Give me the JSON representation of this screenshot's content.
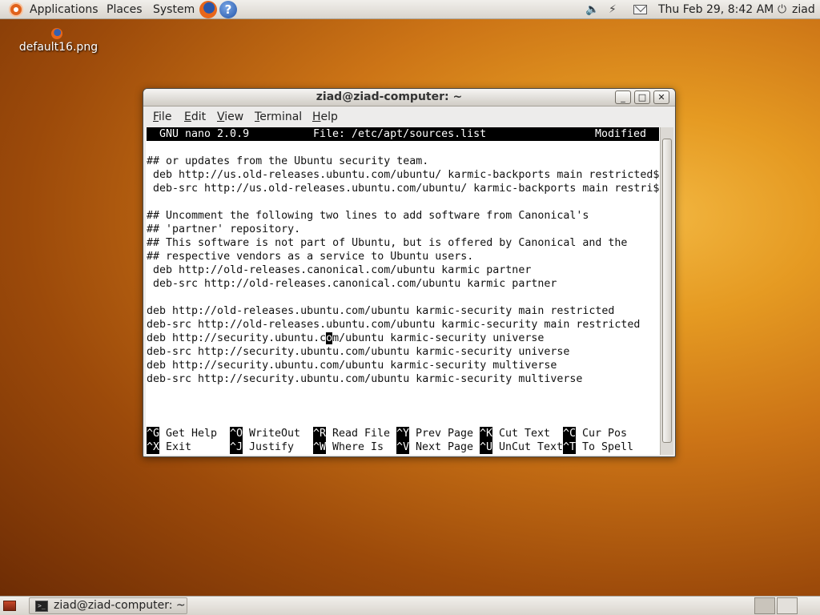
{
  "top_panel": {
    "menus": [
      "Applications",
      "Places",
      "System"
    ],
    "help_glyph": "?",
    "clock": "Thu Feb 29,  8:42 AM",
    "user": "ziad",
    "icons": [
      "ubuntu-logo-icon",
      "firefox-icon",
      "help-icon",
      "volume-icon",
      "network-icon",
      "mail-icon",
      "power-icon"
    ]
  },
  "desktop": {
    "icon_label": "default16.png"
  },
  "window": {
    "title": "ziad@ziad-computer: ~",
    "buttons": {
      "minimize": "_",
      "maximize": "□",
      "close": "✕"
    },
    "menus": [
      "File",
      "Edit",
      "View",
      "Terminal",
      "Help"
    ]
  },
  "nano": {
    "version": "GNU nano 2.0.9",
    "file": "File: /etc/apt/sources.list",
    "status": "Modified",
    "lines": [
      "",
      "## or updates from the Ubuntu security team.",
      " deb http://us.old-releases.ubuntu.com/ubuntu/ karmic-backports main restricted$",
      " deb-src http://us.old-releases.ubuntu.com/ubuntu/ karmic-backports main restri$",
      "",
      "## Uncomment the following two lines to add software from Canonical's",
      "## 'partner' repository.",
      "## This software is not part of Ubuntu, but is offered by Canonical and the",
      "## respective vendors as a service to Ubuntu users.",
      " deb http://old-releases.canonical.com/ubuntu karmic partner",
      " deb-src http://old-releases.canonical.com/ubuntu karmic partner",
      "",
      "deb http://old-releases.ubuntu.com/ubuntu karmic-security main restricted",
      "deb-src http://old-releases.ubuntu.com/ubuntu karmic-security main restricted",
      "deb http://security.ubuntu.com/ubuntu karmic-security universe",
      "deb-src http://security.ubuntu.com/ubuntu karmic-security universe",
      "deb http://security.ubuntu.com/ubuntu karmic-security multiverse",
      "deb-src http://security.ubuntu.com/ubuntu karmic-security multiverse"
    ],
    "cursor": {
      "line": 14,
      "column": 28
    },
    "shortcuts": [
      [
        {
          "key": "^G",
          "label": "Get Help"
        },
        {
          "key": "^O",
          "label": "WriteOut"
        },
        {
          "key": "^R",
          "label": "Read File"
        },
        {
          "key": "^Y",
          "label": "Prev Page"
        },
        {
          "key": "^K",
          "label": "Cut Text"
        },
        {
          "key": "^C",
          "label": "Cur Pos"
        }
      ],
      [
        {
          "key": "^X",
          "label": "Exit"
        },
        {
          "key": "^J",
          "label": "Justify"
        },
        {
          "key": "^W",
          "label": "Where Is"
        },
        {
          "key": "^V",
          "label": "Next Page"
        },
        {
          "key": "^U",
          "label": "UnCut Text"
        },
        {
          "key": "^T",
          "label": "To Spell"
        }
      ]
    ]
  },
  "taskbar": {
    "task_label": "ziad@ziad-computer: ~",
    "terminal_glyph": ">_",
    "workspaces": 2,
    "active_workspace": 1
  }
}
